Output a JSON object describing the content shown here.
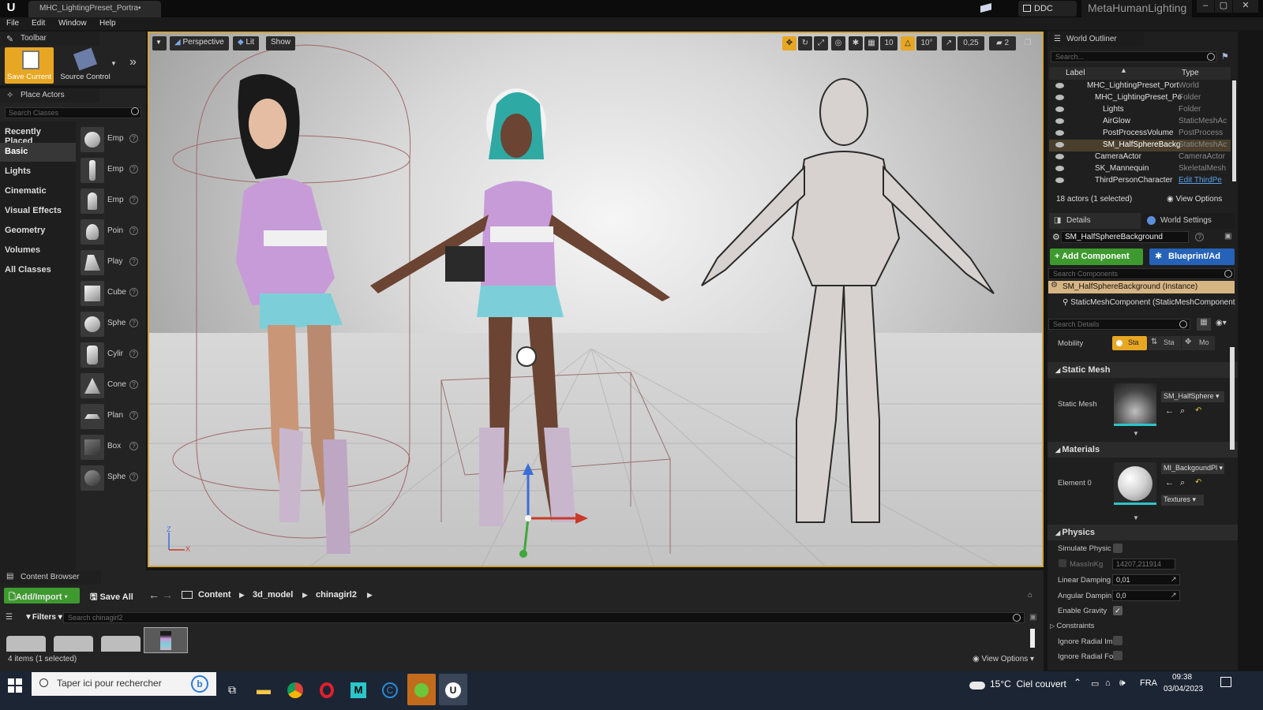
{
  "titlebar": {
    "tab": "MHC_LightingPreset_Portra•",
    "ddc": "DDC",
    "project": "MetaHumanLighting",
    "win_min": "–",
    "win_max": "▢",
    "win_close": "✕"
  },
  "menu": [
    "File",
    "Edit",
    "Window",
    "Help"
  ],
  "toolbar": {
    "title": "Toolbar",
    "save": "Save Current",
    "source": "Source Control"
  },
  "place_actors": {
    "title": "Place Actors",
    "search_placeholder": "Search Classes",
    "categories": [
      "Recently Placed",
      "Basic",
      "Lights",
      "Cinematic",
      "Visual Effects",
      "Geometry",
      "Volumes",
      "All Classes"
    ],
    "actors": [
      "Emp",
      "Emp",
      "Emp",
      "Poin",
      "Play",
      "Cube",
      "Sphe",
      "Cylir",
      "Cone",
      "Plan",
      "Box",
      "Sphe"
    ]
  },
  "viewport": {
    "perspective": "Perspective",
    "lit": "Lit",
    "show": "Show",
    "grid": "10",
    "angle": "10°",
    "scale": "0,25",
    "cams": "2",
    "axis_z": "Z",
    "axis_x": "X"
  },
  "outliner": {
    "title": "World Outliner",
    "search_placeholder": "Search...",
    "col_label": "Label",
    "col_type": "Type",
    "rows": [
      {
        "label": "MHC_LightingPreset_Port",
        "type": "World"
      },
      {
        "label": "MHC_LightingPreset_Po",
        "type": "Folder"
      },
      {
        "label": "Lights",
        "type": "Folder"
      },
      {
        "label": "AirGlow",
        "type": "StaticMeshAc"
      },
      {
        "label": "PostProcessVolume",
        "type": "PostProcess"
      },
      {
        "label": "SM_HalfSphereBackg",
        "type": "StaticMeshAc"
      },
      {
        "label": "CameraActor",
        "type": "CameraActor"
      },
      {
        "label": "SK_Mannequin",
        "type": "SkeletalMesh"
      },
      {
        "label": "ThirdPersonCharacter",
        "type": "Edit ThirdPe"
      }
    ],
    "count": "18 actors (1 selected)",
    "view_options": "View Options"
  },
  "details": {
    "tab_details": "Details",
    "tab_world": "World Settings",
    "name": "SM_HalfSphereBackground",
    "add_component": "+ Add Component",
    "blueprint": "Blueprint/Ad",
    "search_components": "Search Components",
    "instance": "SM_HalfSphereBackground (Instance)",
    "component": "StaticMeshComponent (StaticMeshComponent",
    "search_details": "Search Details",
    "mobility_label": "Mobility",
    "mobility_opts": [
      "Sta",
      "Sta",
      "Mo"
    ],
    "sec_static_mesh": "Static Mesh",
    "static_mesh_label": "Static Mesh",
    "static_mesh_value": "SM_HalfSphere",
    "sec_materials": "Materials",
    "element0": "Element 0",
    "material_value": "MI_BackgoundPl",
    "textures": "Textures",
    "sec_physics": "Physics",
    "simulate": "Simulate Physic",
    "mass": "MassInKg",
    "mass_value": "14207,211914",
    "linear_damping": "Linear Damping",
    "linear_value": "0,01",
    "angular_damping": "Angular Dampin",
    "angular_value": "0,0",
    "enable_gravity": "Enable Gravity",
    "constraints": "Constraints",
    "ignore_im": "Ignore Radial Im",
    "ignore_fo": "Ignore Radial Fo"
  },
  "content_browser": {
    "title": "Content Browser",
    "add": "Add/Import",
    "save_all": "Save All",
    "path": [
      "Content",
      "3d_model",
      "chinagirl2"
    ],
    "filters": "Filters",
    "search_placeholder": "Search chinagirl2",
    "count": "4 items (1 selected)",
    "view_options": "View Options"
  },
  "taskbar": {
    "search": "Taper ici pour rechercher",
    "weather": "15°C  Ciel couvert",
    "lang": "FRA",
    "time": "09:38",
    "date": "03/04/2023"
  }
}
